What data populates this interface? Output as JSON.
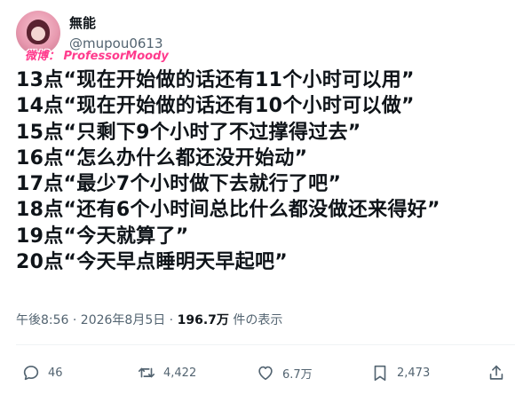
{
  "author": {
    "display_name": "無能",
    "handle": "@mupou0613",
    "avatar_icon": "avatar-image"
  },
  "watermark": {
    "text": "微博： ProfessorMoody",
    "color": "#ff3b8d"
  },
  "tweet": {
    "lines": [
      "13点“现在开始做的话还有11个小时可以用”",
      "14点“现在开始做的话还有10个小时可以做”",
      "15点“只剩下9个小时了不过撑得过去”",
      "16点“怎么办什么都还没开始动”",
      "17点“最少7个小时做下去就行了吧”",
      "18点“还有6个小时间总比什么都没做还来得好”",
      "19点“今天就算了”",
      "20点“今天早点睡明天早起吧”"
    ]
  },
  "meta": {
    "timestamp": "午後8:56 · 2026年8月5日 · ",
    "views": "196.7万",
    "views_suffix": " 件の表示"
  },
  "actions": {
    "reply_count": "46",
    "retweet_count": "4,422",
    "like_count": "6.7万",
    "bookmark_count": "2,473",
    "icons": [
      "reply-icon",
      "retweet-icon",
      "like-icon",
      "bookmark-icon",
      "share-icon"
    ]
  },
  "colors": {
    "text": "#0f1419",
    "secondary": "#536471",
    "divider": "#eff3f4"
  }
}
